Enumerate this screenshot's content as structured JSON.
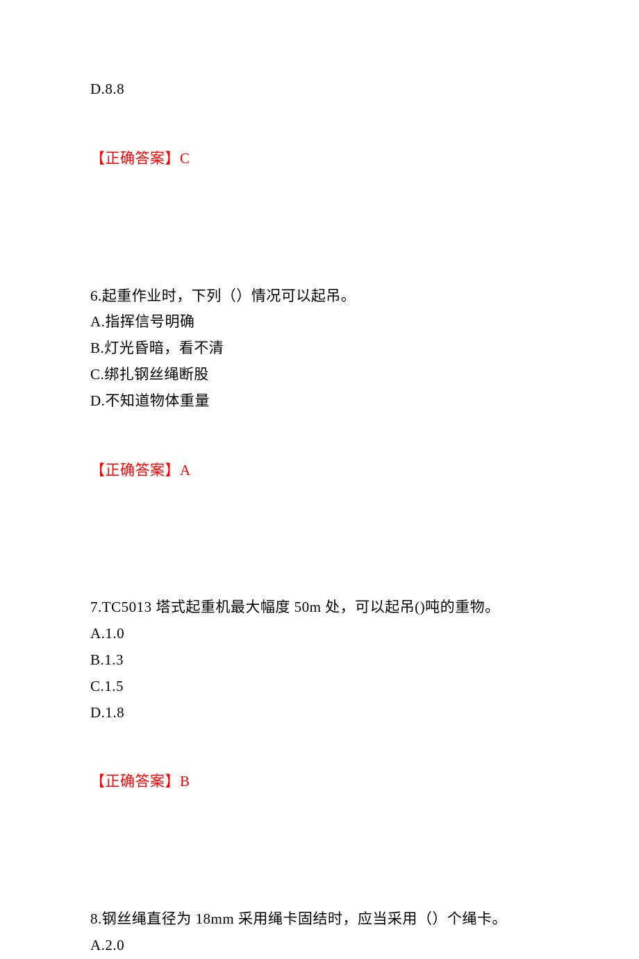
{
  "leading_option": "D.8.8",
  "leading_answer": "【正确答案】C",
  "q6": {
    "stem": "6.起重作业时，下列（）情况可以起吊。",
    "optA": "A.指挥信号明确",
    "optB": "B.灯光昏暗，看不清",
    "optC": "C.绑扎钢丝绳断股",
    "optD": "D.不知道物体重量",
    "answer": "【正确答案】A"
  },
  "q7": {
    "stem": "7.TC5013 塔式起重机最大幅度 50m 处，可以起吊()吨的重物。",
    "optA": "A.1.0",
    "optB": "B.1.3",
    "optC": "C.1.5",
    "optD": "D.1.8",
    "answer": "【正确答案】B"
  },
  "q8": {
    "stem": "8.钢丝绳直径为 18mm 采用绳卡固结时，应当采用（）个绳卡。",
    "optA": "A.2.0"
  }
}
